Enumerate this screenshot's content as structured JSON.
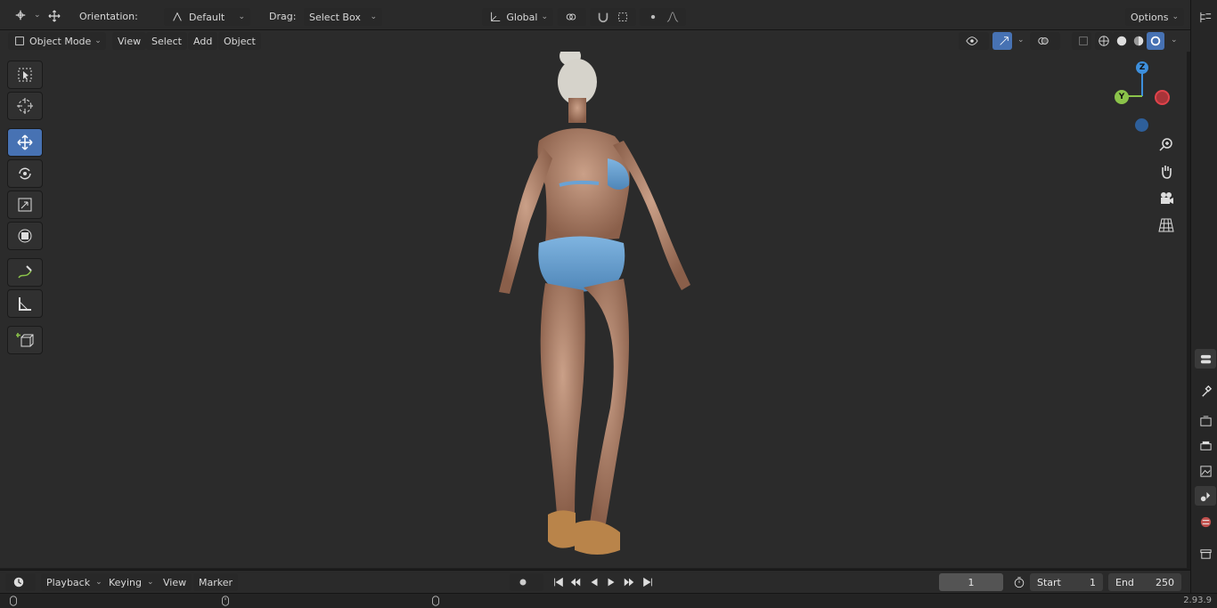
{
  "header": {
    "orientation_label": "Orientation:",
    "orientation_value": "Default",
    "drag_label": "Drag:",
    "drag_value": "Select Box",
    "transform_orientation": "Global",
    "options_label": "Options"
  },
  "viewport_header": {
    "mode": "Object Mode",
    "menus": [
      "View",
      "Select",
      "Add",
      "Object"
    ]
  },
  "gizmo": {
    "z": "Z",
    "y": "Y"
  },
  "timeline": {
    "menus": [
      "Playback",
      "Keying",
      "View",
      "Marker"
    ],
    "current_frame": "1",
    "start_label": "Start",
    "start_value": "1",
    "end_label": "End",
    "end_value": "250"
  },
  "status": {
    "version": "2.93.9"
  },
  "colors": {
    "accent": "#4772b3",
    "axis_x": "#e0434b",
    "axis_y": "#8bc34a",
    "axis_z": "#3d8fdc"
  }
}
